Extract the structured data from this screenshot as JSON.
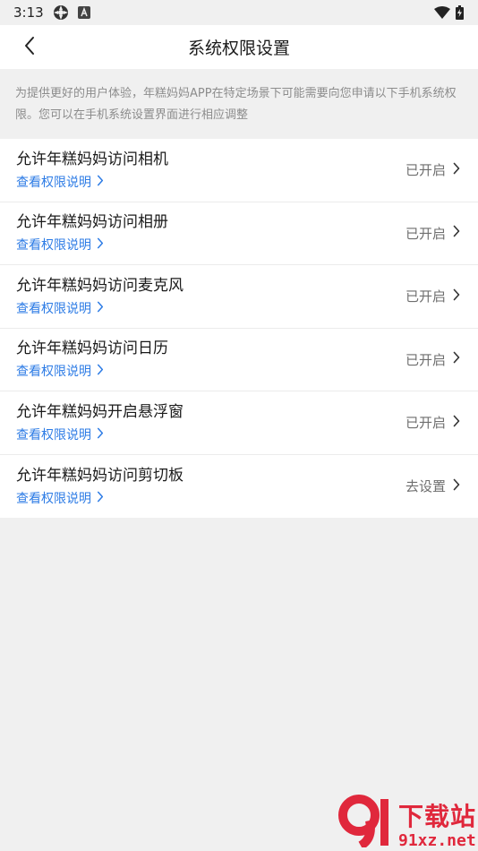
{
  "status_bar": {
    "time": "3:13",
    "icons": [
      "gear-icon",
      "a-badge-icon",
      "wifi-icon",
      "battery-icon"
    ]
  },
  "navbar": {
    "title": "系统权限设置",
    "back_icon": "chevron-left-icon"
  },
  "notice": {
    "text": "为提供更好的用户体验，年糕妈妈APP在特定场景下可能需要向您申请以下手机系统权限。您可以在手机系统设置界面进行相应调整"
  },
  "permissions": [
    {
      "label": "允许年糕妈妈访问相机",
      "link": "查看权限说明",
      "status": "已开启"
    },
    {
      "label": "允许年糕妈妈访问相册",
      "link": "查看权限说明",
      "status": "已开启"
    },
    {
      "label": "允许年糕妈妈访问麦克风",
      "link": "查看权限说明",
      "status": "已开启"
    },
    {
      "label": "允许年糕妈妈访问日历",
      "link": "查看权限说明",
      "status": "已开启"
    },
    {
      "label": "允许年糕妈妈开启悬浮窗",
      "link": "查看权限说明",
      "status": "已开启"
    },
    {
      "label": "允许年糕妈妈访问剪切板",
      "link": "查看权限说明",
      "status": "去设置"
    }
  ],
  "watermark": {
    "top": "下载站",
    "bottom": "91xz.net"
  },
  "colors": {
    "link": "#2c7be5",
    "background": "#f0f0f0",
    "watermark": "#e0283c"
  }
}
